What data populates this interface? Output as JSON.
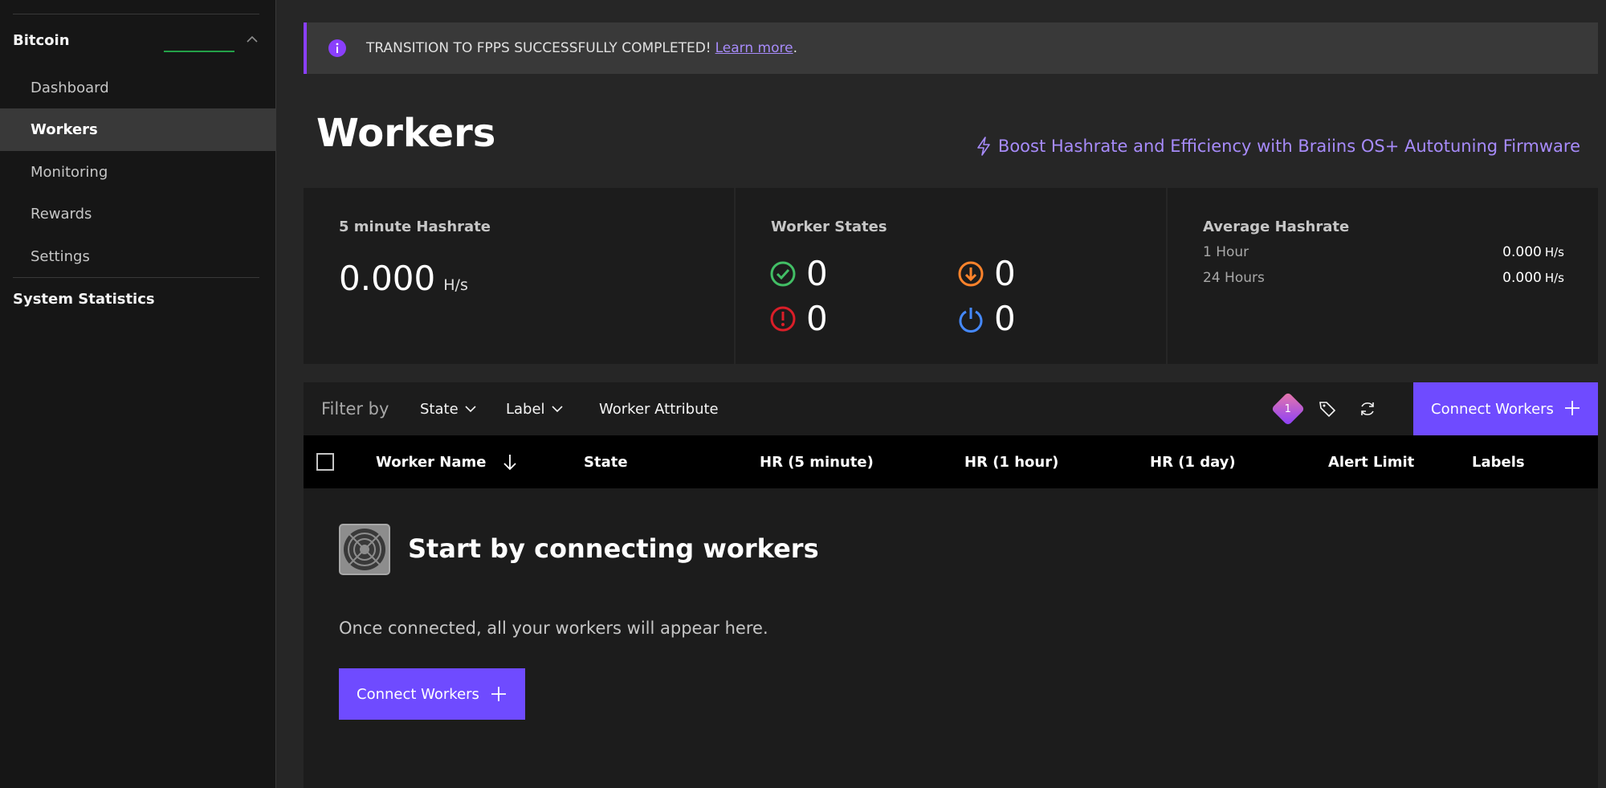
{
  "sidebar": {
    "section_title": "Bitcoin",
    "items": [
      {
        "label": "Dashboard"
      },
      {
        "label": "Workers"
      },
      {
        "label": "Monitoring"
      },
      {
        "label": "Rewards"
      },
      {
        "label": "Settings"
      }
    ],
    "active_item": "Workers",
    "system_statistics": "System Statistics"
  },
  "banner": {
    "message": "TRANSITION TO FPPS SUCCESSFULLY COMPLETED!",
    "link_text": "Learn more",
    "suffix": "."
  },
  "page": {
    "title": "Workers",
    "boost_link": "Boost Hashrate and Efficiency with Braiins OS+ Autotuning Firmware"
  },
  "stats": {
    "hashrate": {
      "title": "5 minute Hashrate",
      "value": "0.000",
      "unit": "H/s"
    },
    "worker_states": {
      "title": "Worker States",
      "ok": "0",
      "low": "0",
      "error": "0",
      "off": "0"
    },
    "average": {
      "title": "Average Hashrate",
      "rows": [
        {
          "label": "1 Hour",
          "value": "0.000",
          "unit": "H/s"
        },
        {
          "label": "24 Hours",
          "value": "0.000",
          "unit": "H/s"
        }
      ]
    }
  },
  "toolbar": {
    "filter_by": "Filter by",
    "state": "State",
    "label": "Label",
    "worker_attribute": "Worker Attribute",
    "badge_count": "1",
    "connect_label": "Connect Workers"
  },
  "table": {
    "columns": [
      "Worker Name",
      "State",
      "HR (5 minute)",
      "HR (1 hour)",
      "HR (1 day)",
      "Alert Limit",
      "Labels"
    ]
  },
  "empty_state": {
    "title": "Start by connecting workers",
    "description": "Once connected, all your workers will appear here.",
    "button": "Connect Workers"
  },
  "colors": {
    "accent": "#6f4bff",
    "link": "#a78bfa",
    "ok": "#42be65",
    "low": "#ff832b",
    "error": "#da1e28",
    "off": "#4589ff"
  }
}
